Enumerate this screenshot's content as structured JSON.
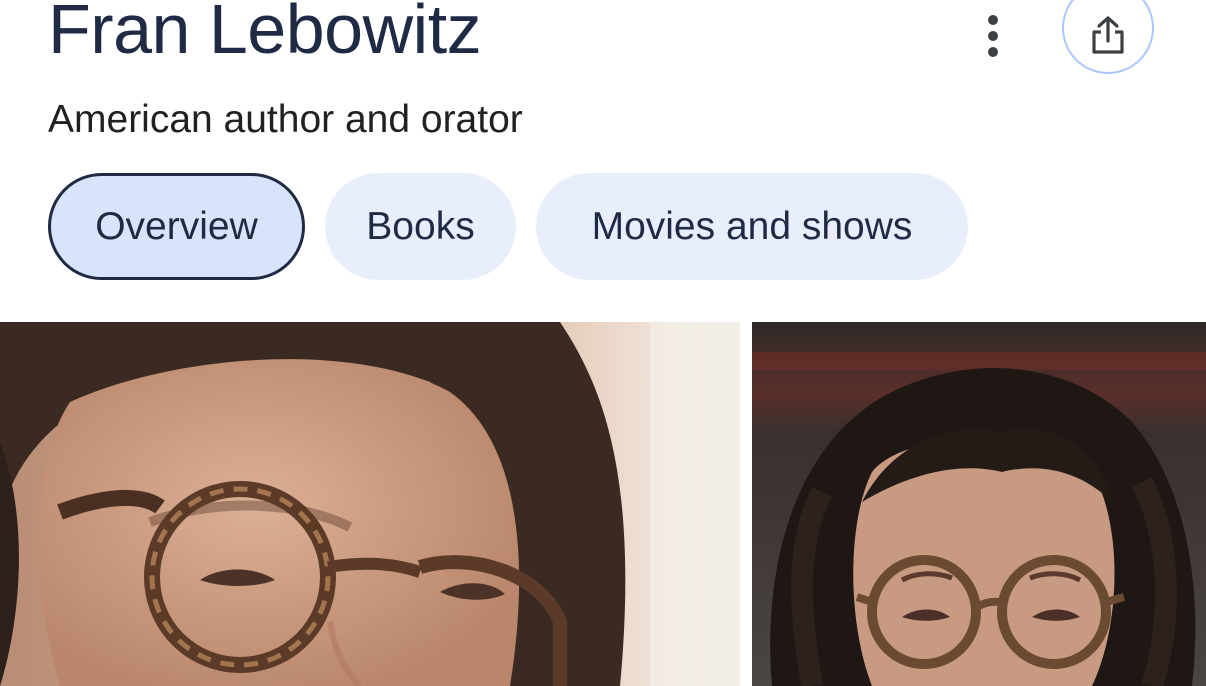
{
  "header": {
    "title": "Fran Lebowitz",
    "subtitle": "American author and orator"
  },
  "actions": {
    "more_icon": "more-vertical-icon",
    "share_icon": "share-icon"
  },
  "tabs": [
    {
      "label": "Overview",
      "selected": true
    },
    {
      "label": "Books",
      "selected": false
    },
    {
      "label": "Movies and shows",
      "selected": false
    }
  ],
  "colors": {
    "title_text": "#1f2a44",
    "tab_background": "#e8eefc",
    "tab_selected_background": "#d7e4fb",
    "share_ring": "#a8c7fa"
  }
}
